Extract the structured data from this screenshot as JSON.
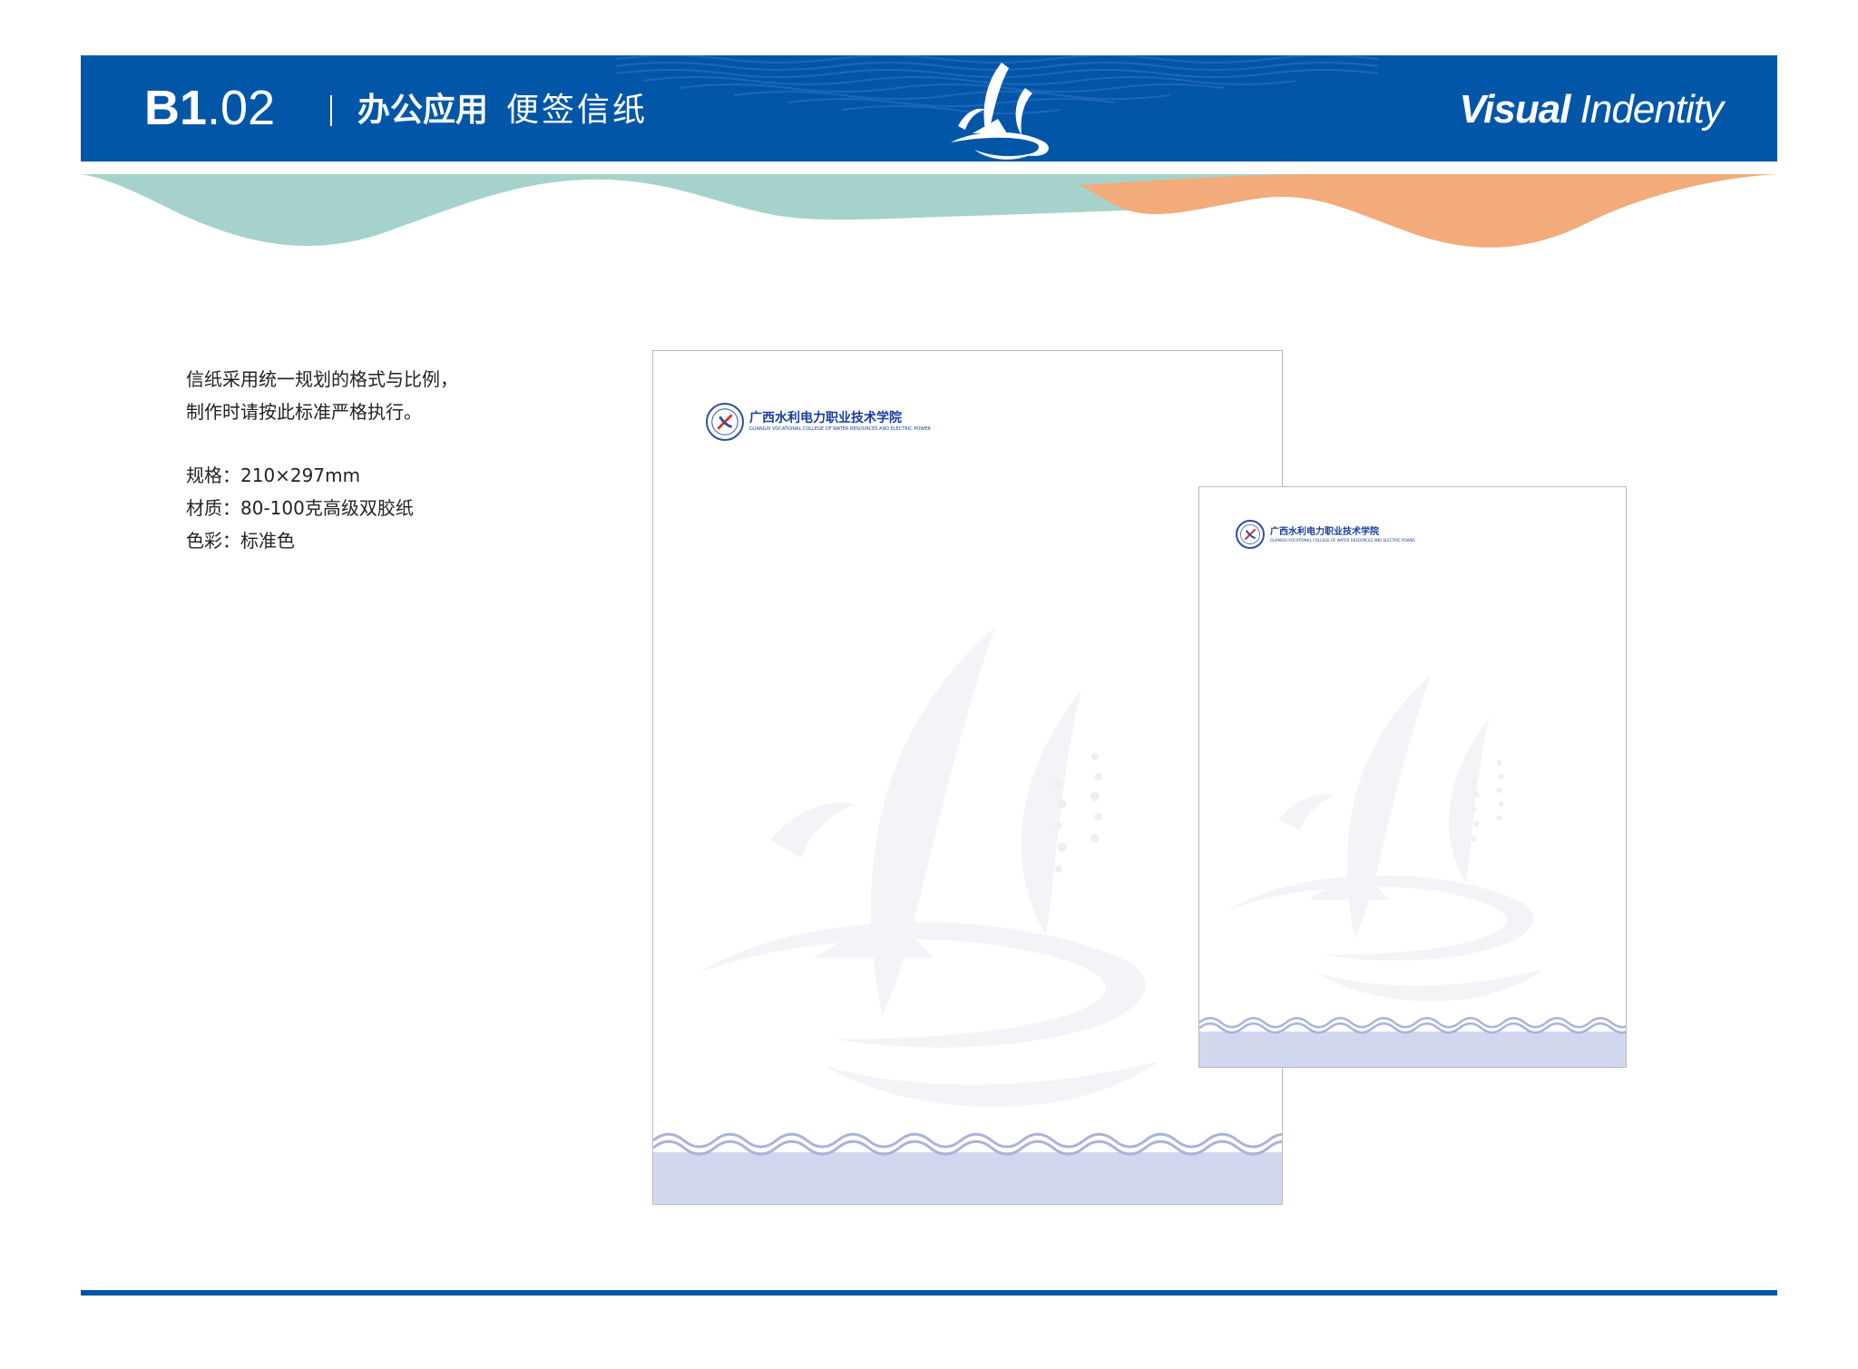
{
  "header": {
    "code_major": "B1",
    "code_minor": ".02",
    "section_main": "办公应用",
    "section_sub": "便签信纸",
    "vi_bold": "Visual",
    "vi_rest": " Indentity",
    "logo_icon": "sail-wave-logo-icon"
  },
  "description": {
    "line1": "信纸采用统一规划的格式与比例，",
    "line2": "制作时请按此标准严格执行。",
    "spec": "规格：210×297mm",
    "material": "材质：80-100克高级双胶纸",
    "color": "色彩：标准色"
  },
  "letterhead": {
    "school_cn": "广西水利电力职业技术学院",
    "school_en": "GUANGXI VOCATIONAL COLLEGE OF WATER RESOURCES AND ELECTRIC POWER"
  },
  "colors": {
    "brand_blue": "#0256a8",
    "wave_teal": "#a5d3cc",
    "wave_orange": "#f3ab7b",
    "footer_band": "#d0d7ee",
    "watermark": "#f3f4f8"
  }
}
